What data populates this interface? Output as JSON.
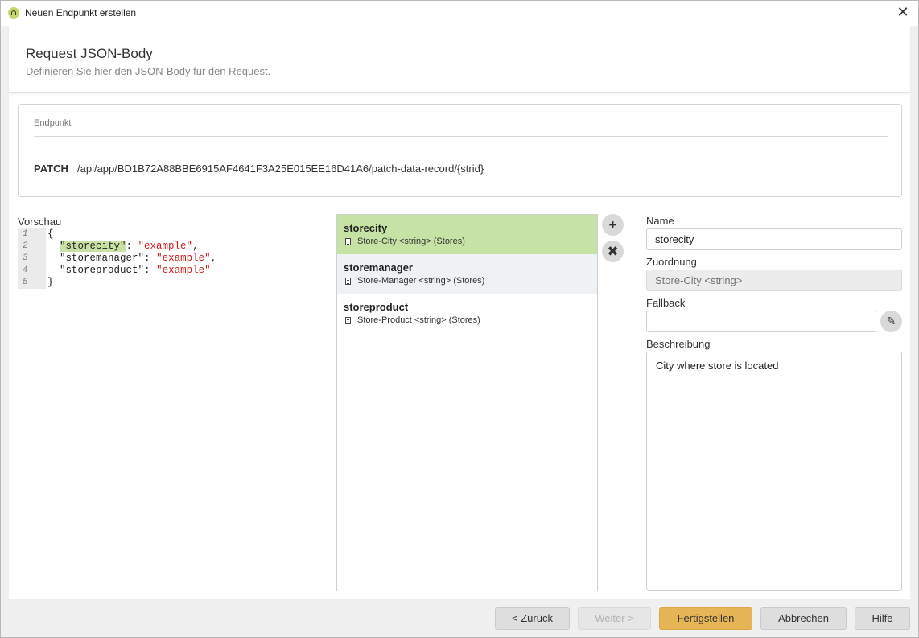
{
  "window": {
    "title": "Neuen Endpunkt erstellen",
    "close_glyph": "✕"
  },
  "header": {
    "title": "Request JSON-Body",
    "subtitle": "Definieren Sie hier den JSON-Body für den Request."
  },
  "endpoint": {
    "label": "Endpunkt",
    "method": "PATCH",
    "path": "/api/app/BD1B72A88BBE6915AF4641F3A25E015EE16D41A6/patch-data-record/{strid}"
  },
  "preview": {
    "label": "Vorschau",
    "lines": [
      {
        "num": "1",
        "open": "{"
      },
      {
        "num": "2",
        "indent": "  ",
        "key": "\"storecity\"",
        "sep": ": ",
        "value": "\"example\"",
        "end": ","
      },
      {
        "num": "3",
        "indent": "  ",
        "key": "\"storemanager\"",
        "sep": ": ",
        "value": "\"example\"",
        "end": ","
      },
      {
        "num": "4",
        "indent": "  ",
        "key": "\"storeproduct\"",
        "sep": ": ",
        "value": "\"example\"",
        "end": ""
      },
      {
        "num": "5",
        "close": "}"
      }
    ]
  },
  "fields": [
    {
      "name": "storecity",
      "desc": "Store-City <string> (Stores)",
      "icon": "document-icon"
    },
    {
      "name": "storemanager",
      "desc": "Store-Manager <string> (Stores)",
      "icon": "document-icon"
    },
    {
      "name": "storeproduct",
      "desc": "Store-Product <string> (Stores)",
      "icon": "document-icon"
    }
  ],
  "list_actions": {
    "add_glyph": "+",
    "remove_glyph": "✖"
  },
  "details": {
    "name_label": "Name",
    "name_value": "storecity",
    "mapping_label": "Zuordnung",
    "mapping_placeholder": "Store-City <string>",
    "fallback_label": "Fallback",
    "fallback_value": "",
    "edit_glyph": "✎",
    "description_label": "Beschreibung",
    "description_value": "City where store is located"
  },
  "footer": {
    "back": "< Zurück",
    "next": "Weiter >",
    "finish": "Fertigstellen",
    "cancel": "Abbrechen",
    "help": "Hilfe"
  },
  "colors": {
    "selected_row": "#c6e2a4",
    "alt_row": "#eef2f4",
    "primary_button": "#e5b556",
    "json_string": "#d21a1a"
  }
}
